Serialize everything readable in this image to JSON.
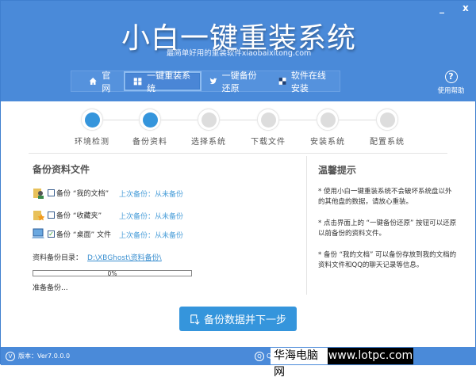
{
  "header": {
    "title": "小白一键重装系统",
    "subtitle": "最简单好用的重装软件xiaobaixitong.com",
    "minimize": "_",
    "close": "x",
    "help": "使用帮助"
  },
  "nav": [
    {
      "label": "官网",
      "icon": "home-icon"
    },
    {
      "label": "一键重装系统",
      "icon": "windows-icon",
      "active": true
    },
    {
      "label": "一键备份还原",
      "icon": "bird-icon"
    },
    {
      "label": "软件在线安装",
      "icon": "squares-icon"
    }
  ],
  "steps": [
    {
      "label": "环境检测",
      "done": true
    },
    {
      "label": "备份资料",
      "done": true
    },
    {
      "label": "选择系统",
      "done": false
    },
    {
      "label": "下载文件",
      "done": false
    },
    {
      "label": "安装系统",
      "done": false
    },
    {
      "label": "配置系统",
      "done": false
    }
  ],
  "backup": {
    "title": "备份资料文件",
    "items": [
      {
        "label": "备份 “我的文档”",
        "checked": false,
        "last": "上次备份：从未备份",
        "icon": "documents-folder-icon"
      },
      {
        "label": "备份 “收藏夹”",
        "checked": false,
        "last": "上次备份：从未备份",
        "icon": "favorites-folder-icon"
      },
      {
        "label": "备份 “桌面” 文件",
        "checked": true,
        "last": "上次备份：从未备份",
        "icon": "desktop-icon"
      }
    ],
    "dir_label": "资料备份目录：",
    "dir_path": "D:\\XBGhost\\资料备份\\",
    "progress": "0%",
    "progress_value": 0,
    "status": "准备备份..."
  },
  "tips": {
    "title": "温馨提示",
    "items": [
      "* 使用小白一键重装系统不会破坏系统盘以外的其他盘的数据，请放心重装。",
      "* 点击界面上的 “一键备份还原” 按钮可以还原以前备份的资料文件。",
      "* 备份 “我的文档” 可以备份存放到我的文档的资料文件和QQ的聊天记录等信息。"
    ]
  },
  "action": {
    "label": "备份数据并下一步"
  },
  "footer": {
    "version": "版本：Ver7.0.0.0",
    "qq": "QQ"
  },
  "watermark": {
    "cn": "华海电脑网",
    "url": "www.lotpc.com"
  }
}
